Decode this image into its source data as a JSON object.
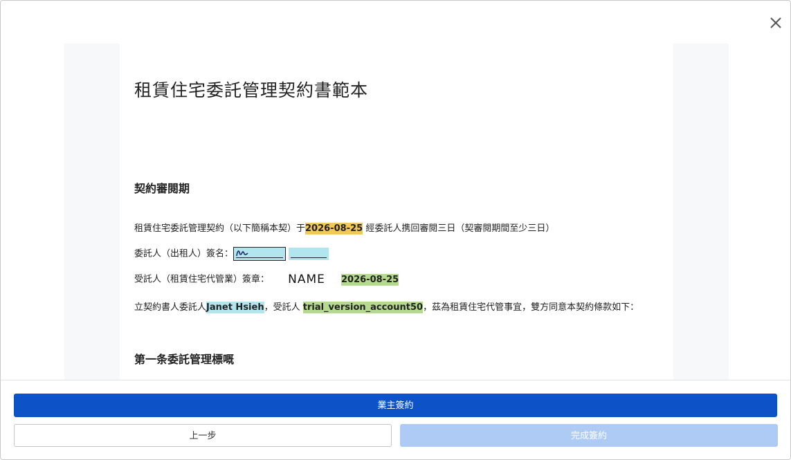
{
  "document": {
    "title": "租賃住宅委託管理契約書範本",
    "review_section": {
      "heading": "契約審閱期",
      "review_text_before": "租賃住宅委託管理契約（以下簡稱本契）于",
      "review_date": "2026-08-25",
      "review_text_after": "經委託人携回審閱三日（契審閱期間至少三日）",
      "client_signature_label": "委託人（出租人）簽名：",
      "client_signature_blank_1": "________",
      "client_signature_blank_2": "________",
      "agent_stamp_label": "受託人（租賃住宅代管業）簽章：",
      "agent_stamp_name": "NAME",
      "agent_stamp_date": "2026-08-25",
      "parties_text_1": "立契約書人委託人",
      "client_name": "Janet Hsieh",
      "parties_text_2": "，受託人 ",
      "agent_account": "trial_version_account50",
      "parties_text_3": "，茲為租賃住宅代管事宜，雙方同意本契約條款如下："
    },
    "article_1": {
      "heading": "第一条委託管理標嘅"
    }
  },
  "footer": {
    "owner_sign_label": "業主簽約",
    "back_label": "上一步",
    "complete_label": "完成簽約"
  },
  "colors": {
    "primary": "#0e52c8",
    "primary_disabled": "#aecbf6",
    "highlight_yellow": "#f2c75c",
    "highlight_green": "#b5d98f",
    "highlight_cyan": "#b2e6ef"
  },
  "icons": {
    "close": "close-icon",
    "signature": "signature-icon"
  }
}
